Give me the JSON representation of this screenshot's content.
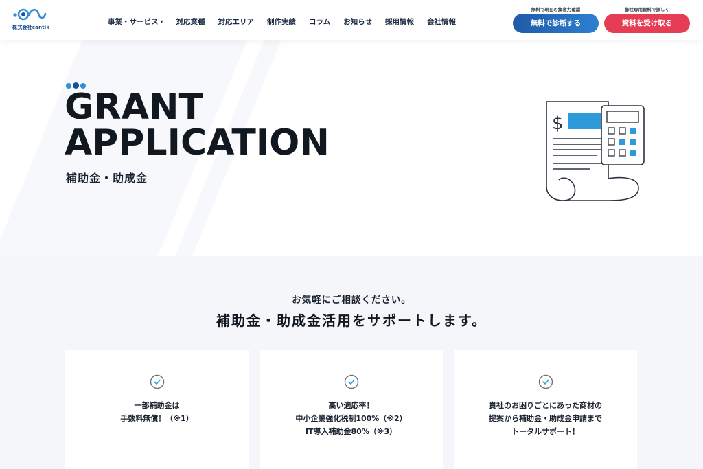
{
  "header": {
    "logo_text": "株式会社cantik",
    "nav": [
      {
        "label": "事業・サービス",
        "has_caret": true
      },
      {
        "label": "対応業種",
        "has_caret": false
      },
      {
        "label": "対応エリア",
        "has_caret": false
      },
      {
        "label": "制作実績",
        "has_caret": false
      },
      {
        "label": "コラム",
        "has_caret": false
      },
      {
        "label": "お知らせ",
        "has_caret": false
      },
      {
        "label": "採用情報",
        "has_caret": false
      },
      {
        "label": "会社情報",
        "has_caret": false
      }
    ],
    "cta_primary": {
      "note": "無料で現在の集客力確認",
      "label": "無料で診断する",
      "color": "#1f5aa8"
    },
    "cta_secondary": {
      "note": "御社専用資料で詳しく",
      "label": "資料を受け取る",
      "color": "#e63d54"
    }
  },
  "hero": {
    "title_line1": "GRANT",
    "title_line2": "APPLICATION",
    "subtitle": "補助金・助成金",
    "accent_color": "#2f8fd8",
    "icon": "invoice-calculator-icon"
  },
  "support": {
    "lead": "お気軽にご相談ください。",
    "heading": "補助金・助成金活用をサポートします。",
    "cards": [
      {
        "icon": "check-circle-icon",
        "lines": [
          "一部補助金は",
          "手数料無償！（※1）"
        ]
      },
      {
        "icon": "check-circle-icon",
        "lines": [
          "高い適応率！",
          "中小企業強化税制100%（※2）",
          "IT導入補助金80%（※3）"
        ]
      },
      {
        "icon": "check-circle-icon",
        "lines": [
          "貴社のお困りごとにあった商材の",
          "提案から補助金・助成金申請まで",
          "トータルサポート！"
        ]
      }
    ]
  }
}
